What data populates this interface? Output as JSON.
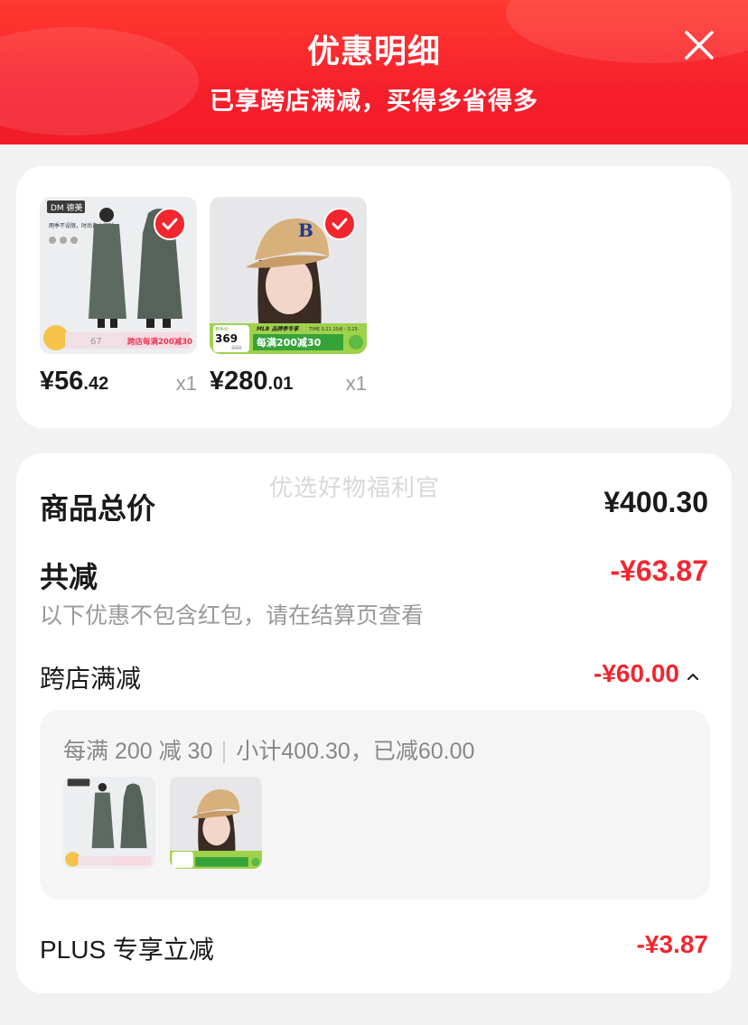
{
  "header": {
    "title": "优惠明细",
    "subtitle": "已享跨店满减，买得多省得多"
  },
  "colors": {
    "accent": "#f2262f",
    "header_bg": "#f6202c",
    "page_bg": "#f2f2f2"
  },
  "products": [
    {
      "price_int": "¥56",
      "price_dec": ".42",
      "qty": "x1",
      "selected": true,
      "image": "grey-raincoat",
      "brand": "DM 德美",
      "tagline": "雨季不设限，时尚自由行就",
      "promo_tag": "跨店每满200减30",
      "badge_price": "67"
    },
    {
      "price_int": "¥280",
      "price_dec": ".01",
      "qty": "x1",
      "selected": true,
      "image": "beige-mlb-cap",
      "promo_tag": "每满200减30",
      "badge_price": "369",
      "badge_orig": "399",
      "badge_label": "到手价",
      "cap_logo": "B",
      "brand_banner": "MLB 品牌季专享",
      "date_label": "TIME 3.21 20点 - 3.25"
    }
  ],
  "summary": {
    "watermark": "优选好物福利官",
    "total_label": "商品总价",
    "total_value": "¥400.30",
    "discount_label": "共减",
    "discount_value": "-¥63.87",
    "discount_note": "以下优惠不包含红包，请在结算页查看",
    "cross_store_label": "跨店满减",
    "cross_store_value": "-¥60.00",
    "cross_store_detail_rule": "每满 200 减 30",
    "cross_store_detail_sum": "小计400.30，已减60.00",
    "plus_label": "PLUS 专享立减",
    "plus_value": "-¥3.87"
  }
}
